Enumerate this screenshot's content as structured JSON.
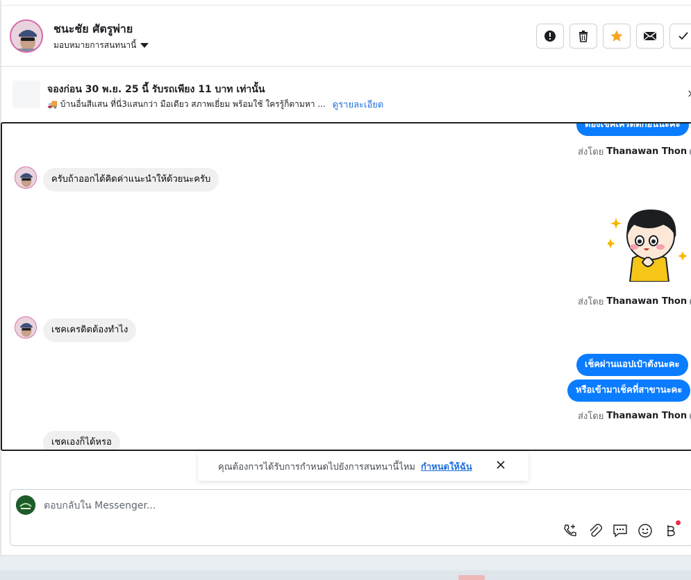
{
  "header": {
    "name": "ชนะชัย ศัตรูพ่าย",
    "assign_label": "มอบหมายการสนทนานี้",
    "actions": [
      {
        "icon": "alert-icon"
      },
      {
        "icon": "trash-icon"
      },
      {
        "icon": "star-icon"
      },
      {
        "icon": "mail-icon"
      },
      {
        "icon": "check-icon"
      }
    ]
  },
  "ad": {
    "title": "จองก่อน 30 พ.ย. 25 นี้ รับรถเพียง 11 บาท เท่านั้น",
    "description": "🚚 บ้านอื่นสีแสน ที่นี่3แสนกว่า มือเดียว สภาพเยี่ยม พร้อมใช้ ใครรู้ก็ตามหา ...",
    "link": "ดูรายละเอียด",
    "close": "×"
  },
  "thread": {
    "msg_out_top": "ต้องเช็คเครดิตก่อนนะคะ",
    "sent_by_prefix": "ส่งโดย",
    "agent_name": "Thanawan Thon",
    "msg_in_1": "ครับถ้าออกได้คิดค่าแนะนำให้ด้วยนะครับ",
    "msg_in_2": "เชคเครดิตต้องทำไง",
    "msg_out_2": "เช็คผ่านแอปเป๋าตังนะคะ",
    "msg_out_3": "หรือเข้ามาเช็คที่สาขานะคะ",
    "msg_in_3": "เชคเองก็ได้หรอ"
  },
  "notice": {
    "text": "คุณต้องการได้รับการกำหนดไปยังการสนทนานี้ไหม",
    "link": "กำหนดให้ฉัน"
  },
  "composer": {
    "placeholder": "ตอบกลับใน Messenger...",
    "tools": [
      "phone-add-icon",
      "paperclip-icon",
      "chat-bubble-icon",
      "emoji-icon",
      "baht-icon"
    ]
  },
  "colors": {
    "bubble_out": "#0a7cff",
    "bubble_in": "#f0f0f0",
    "link": "#216fdb",
    "star": "#f5a623"
  }
}
